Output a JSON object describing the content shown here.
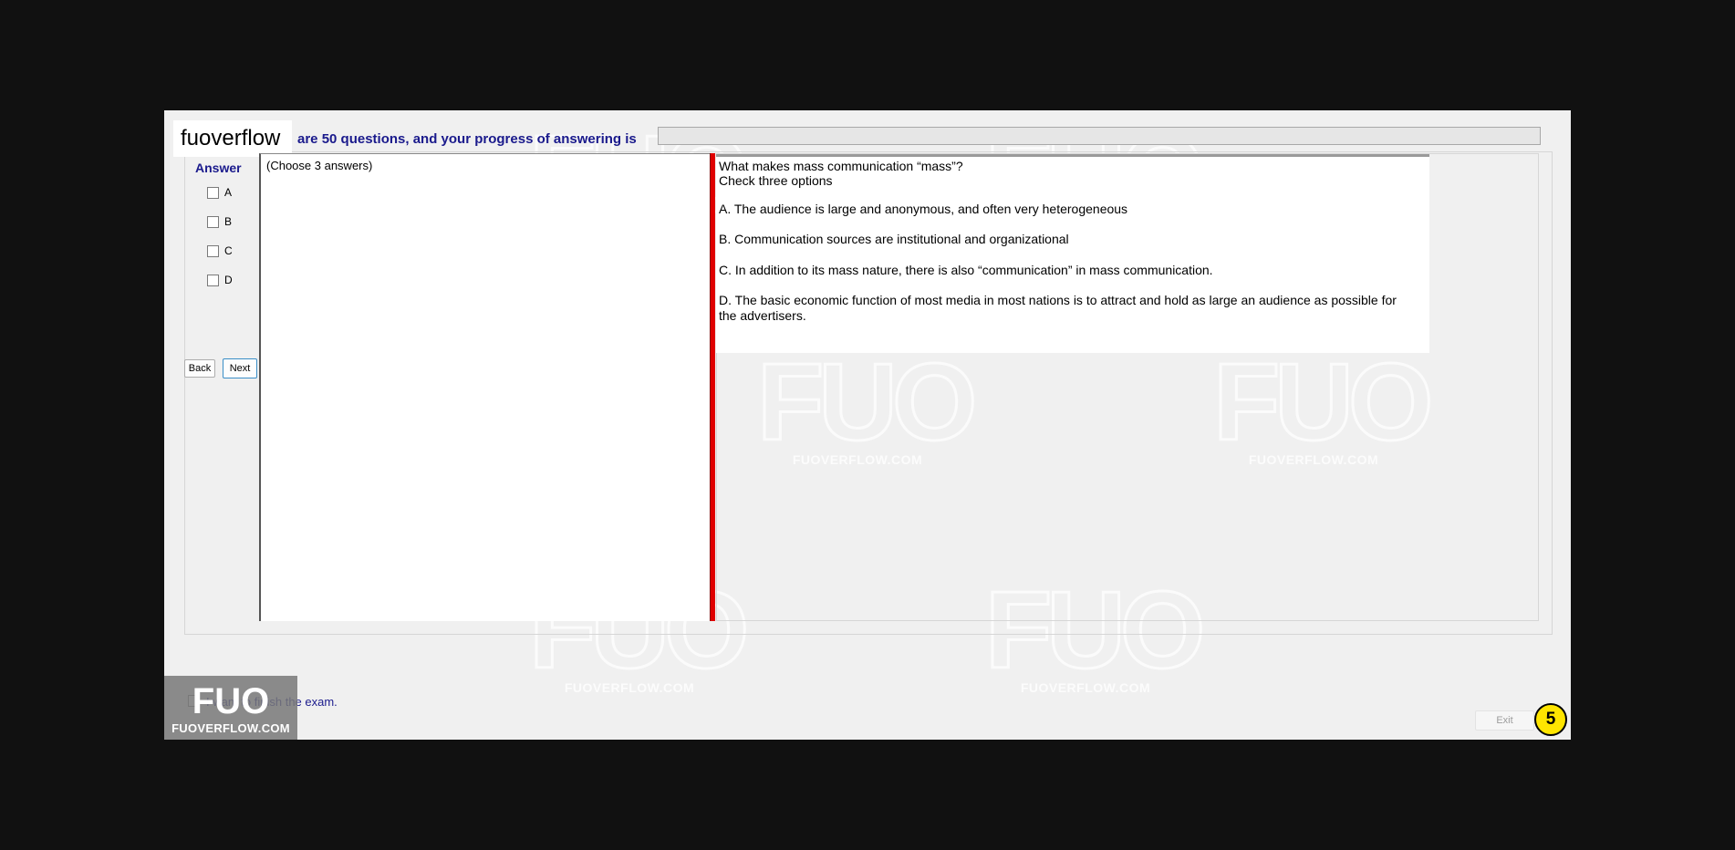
{
  "brand": {
    "name": "fuoverflow"
  },
  "header": {
    "progress_text": "are 50 questions, and your progress of answering is",
    "progress_fraction": 0,
    "colors": {
      "progress_fill": "#06b025",
      "label": "#1a1a8c"
    }
  },
  "answer": {
    "title": "Answer",
    "options": [
      {
        "label": "A",
        "checked": false
      },
      {
        "label": "B",
        "checked": false
      },
      {
        "label": "C",
        "checked": false
      },
      {
        "label": "D",
        "checked": false
      }
    ],
    "back_label": "Back",
    "next_label": "Next",
    "hint": "(Choose 3 answers)"
  },
  "question": {
    "title": "What makes mass communication “mass”?",
    "instruction": "Check three options",
    "options": [
      "A.  The audience is large and anonymous, and often very heterogeneous",
      "B.  Communication sources are institutional and organizational",
      "C.  In addition to its mass nature, there is also “communication” in mass communication.",
      "D.  The basic economic function of most media in most nations is to attract and hold as large an audience as possible for the advertisers."
    ]
  },
  "footer": {
    "finish_label": "I want to finish the exam.",
    "finish_checked": false,
    "exit_label": "Exit",
    "page_number": "5"
  },
  "watermark": {
    "logo": "FUO",
    "site": "FUOVERFLOW.COM"
  },
  "colors": {
    "divider": "#e00000",
    "badge_yellow": "#ffe500",
    "window_bg": "#f0f0f0"
  }
}
